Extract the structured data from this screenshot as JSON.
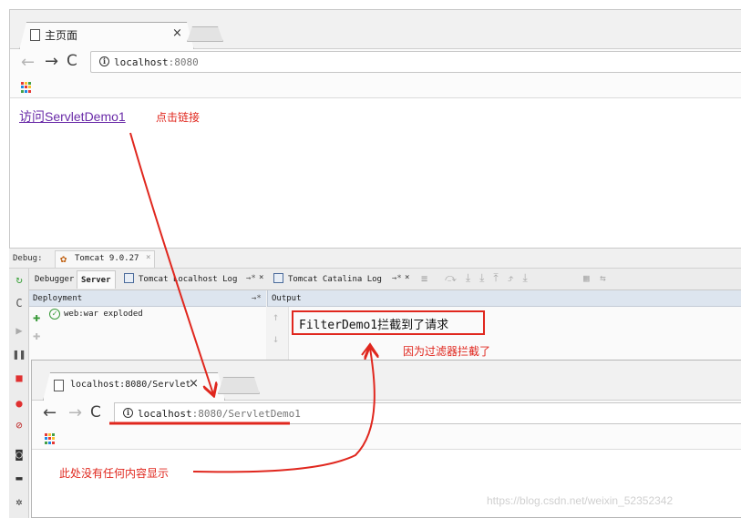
{
  "browser1": {
    "tab_title": "主页面",
    "tab_close": "×",
    "url_host": "localhost",
    "url_rest": ":8080",
    "page_link": "访问ServletDemo1",
    "note_click": "点击链接"
  },
  "ide": {
    "debug_label": "Debug:",
    "run_config": "Tomcat 9.0.27",
    "run_config_close": "×",
    "tabs": [
      "Debugger",
      "Server",
      "Tomcat Localhost Log",
      "Tomcat Catalina Log"
    ],
    "tab_suffix": "→*",
    "tab_close": "×",
    "deployment_header": "Deployment",
    "deployment_header_pin": "→*",
    "output_header": "Output",
    "deploy_item": "web:war exploded",
    "output_text": "FilterDemo1拦截到了请求",
    "note_intercepted": "因为过滤器拦截了"
  },
  "browser2": {
    "tab_title": "localhost:8080/Servlet",
    "tab_close": "×",
    "url_host": "localhost",
    "url_rest": ":8080/ServletDemo1",
    "note_empty": "此处没有任何内容显示"
  },
  "watermark": "https://blog.csdn.net/weixin_52352342",
  "colors": {
    "annotation_red": "#e0271e",
    "link_purple": "#6a2ba8",
    "ide_header_blue": "#dde5ef",
    "check_green": "#3a9a3a"
  }
}
